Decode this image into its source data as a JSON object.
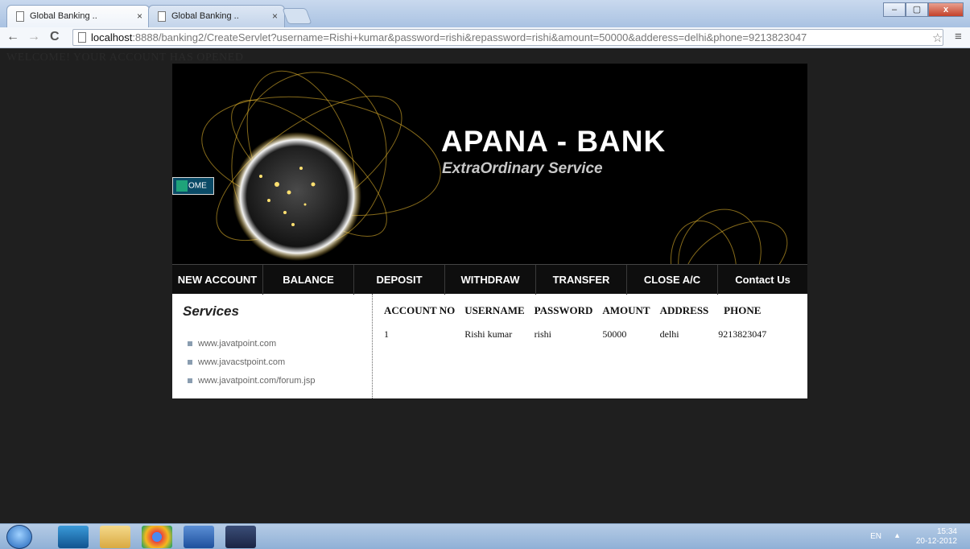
{
  "browser": {
    "tabs": [
      {
        "title": "Global Banking ..",
        "close": "×"
      },
      {
        "title": "Global Banking ..",
        "close": "×"
      }
    ],
    "window_controls": {
      "minimize": "–",
      "maximize": "▢",
      "close": "x"
    },
    "url_host": "localhost",
    "url_rest": ":8888/banking2/CreateServlet?username=Rishi+kumar&password=rishi&repassword=rishi&amount=50000&adderess=delhi&phone=9213823047",
    "back": "←",
    "forward": "→",
    "reload": "C",
    "star": "☆",
    "menu": "≡"
  },
  "page": {
    "welcome": "WELCOME! YOUR ACCOUNT HAS OPENED",
    "bank_title": "APANA - BANK",
    "bank_subtitle": "ExtraOrdinary Service",
    "home_label": "OME",
    "nav": [
      "NEW ACCOUNT",
      "BALANCE",
      "DEPOSIT",
      "WITHDRAW",
      "TRANSFER",
      "CLOSE A/C",
      "Contact Us"
    ],
    "services_title": "Services",
    "links": [
      "www.javatpoint.com",
      "www.javacstpoint.com",
      "www.javatpoint.com/forum.jsp"
    ],
    "table": {
      "headers": [
        "ACCOUNT NO",
        "USERNAME",
        "PASSWORD",
        "AMOUNT",
        "ADDRESS",
        "PHONE"
      ],
      "rows": [
        [
          "1",
          "Rishi kumar",
          "rishi",
          "50000",
          "delhi",
          "9213823047"
        ]
      ]
    }
  },
  "taskbar": {
    "apps": [
      "windows-start",
      "outlook",
      "file-explorer",
      "chrome",
      "word",
      "eclipse"
    ],
    "lang": "EN",
    "tray_arrow": "▲",
    "time": "15:34",
    "date": "20-12-2012"
  },
  "colors": {
    "page_bg": "#1f1f1f",
    "banner_bg": "#000000",
    "globe_glow": "#f0c030"
  }
}
